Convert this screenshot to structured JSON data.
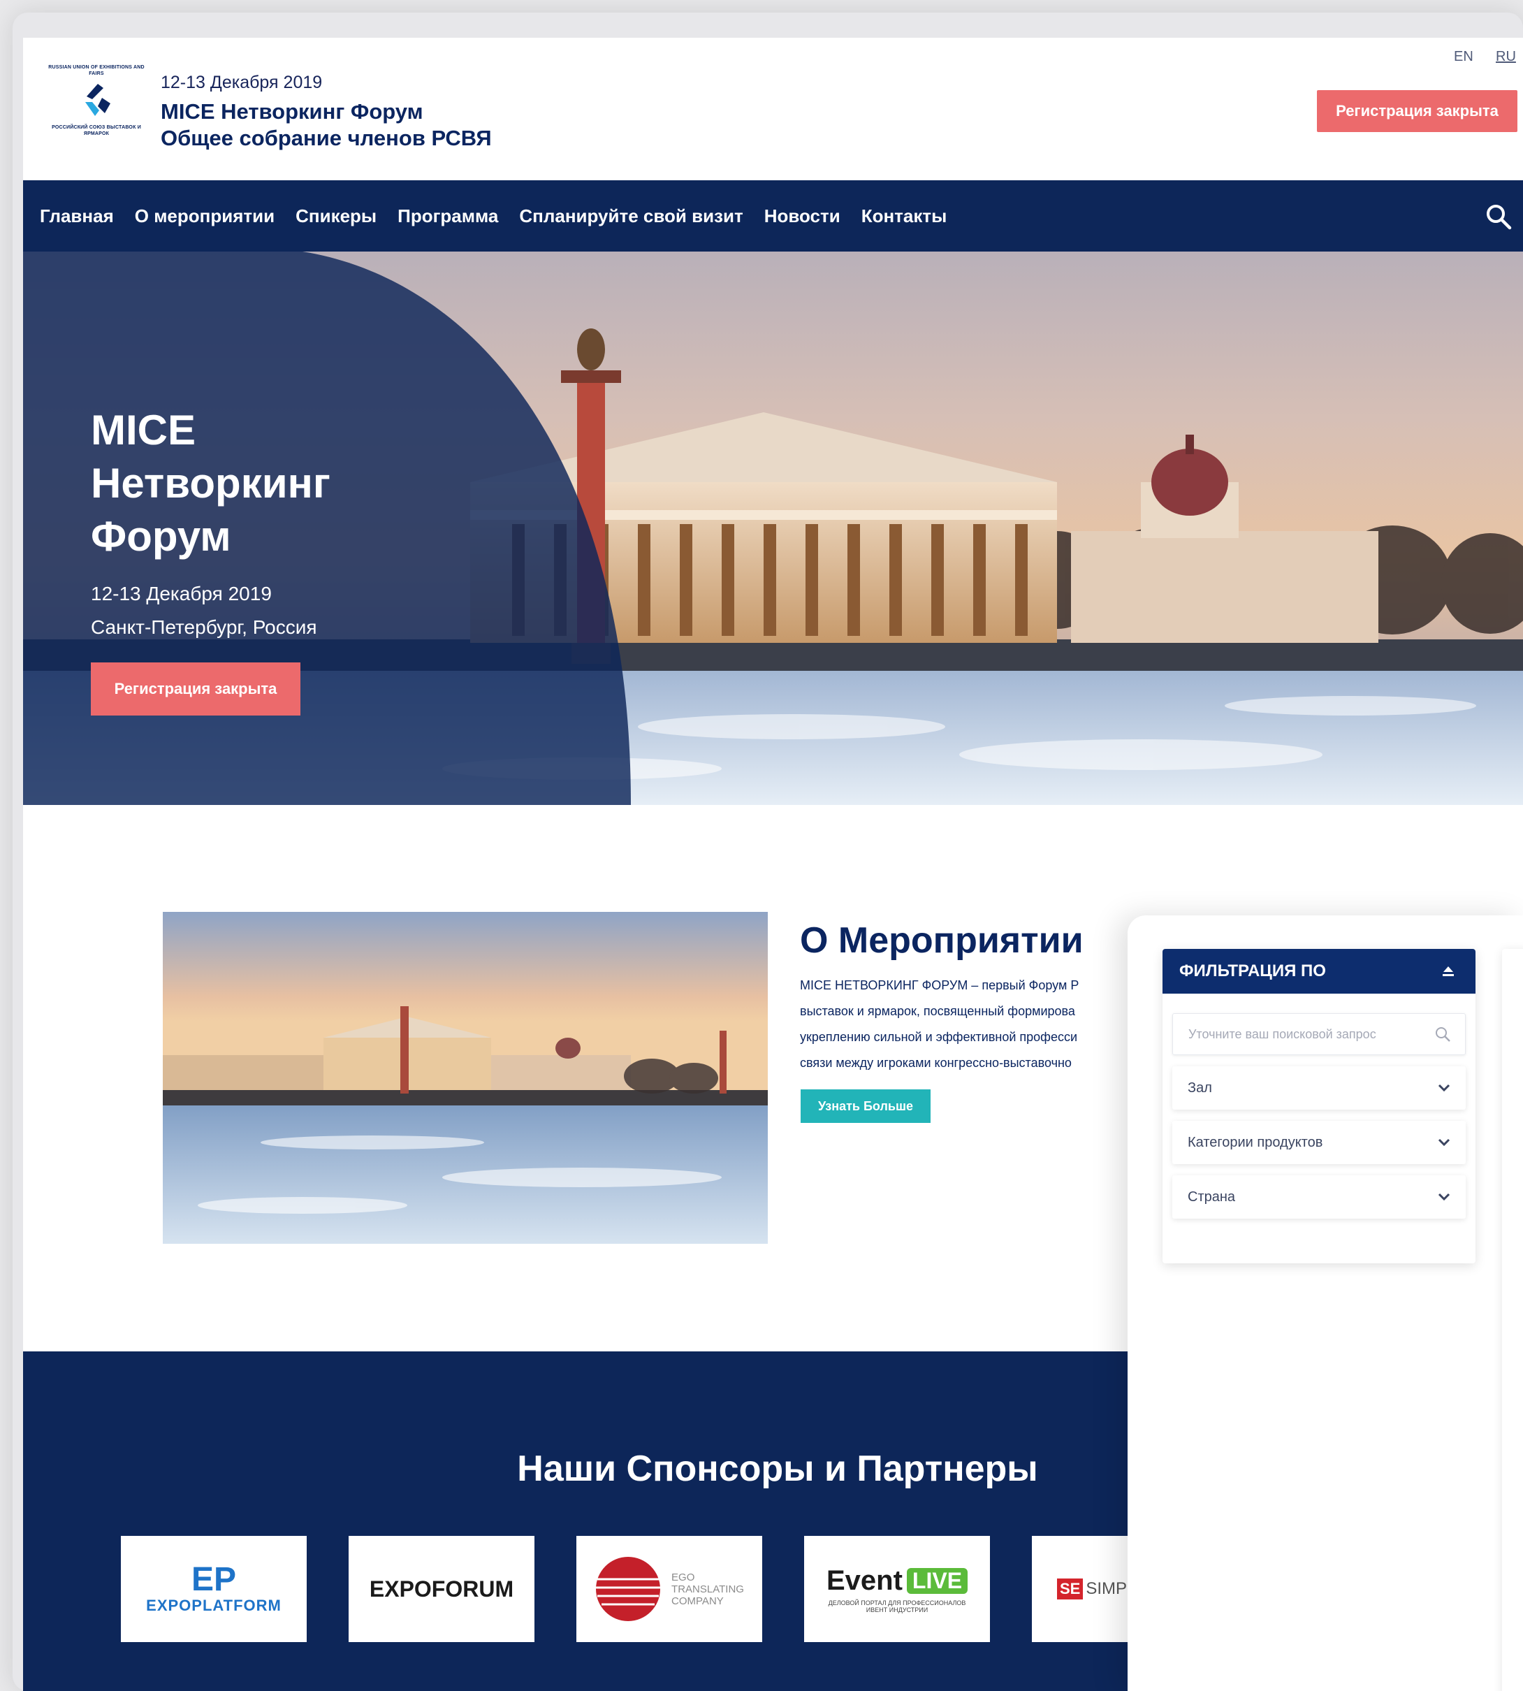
{
  "header": {
    "logo_top": "RUSSIAN UNION OF EXHIBITIONS AND FAIRS",
    "logo_bottom": "РОССИЙСКИЙ СОЮЗ ВЫСТАВОК И ЯРМАРОК",
    "date": "12-13 Декабря 2019",
    "title_line1": "MICE Нетворкинг Форум",
    "title_line2": "Общее собрание членов РСВЯ",
    "lang_en": "EN",
    "lang_ru": "RU",
    "register_label": "Регистрация закрыта"
  },
  "nav": {
    "items": [
      {
        "label": "Главная"
      },
      {
        "label": "О мероприятии"
      },
      {
        "label": "Спикеры"
      },
      {
        "label": "Программа"
      },
      {
        "label": "Спланируйте свой визит"
      },
      {
        "label": "Новости"
      },
      {
        "label": "Контакты"
      }
    ],
    "search_icon": "search-icon"
  },
  "hero": {
    "title": "MICE Нетворкинг Форум",
    "date": "12-13 Декабря 2019",
    "location": "Санкт-Петербург, Россия",
    "register_label": "Регистрация закрыта"
  },
  "about": {
    "title": "О Мероприятии",
    "text_lines": [
      "MICE НЕТВОРКИНГ ФОРУМ – первый Форум Р",
      "выставок и ярмарок, посвященный формирова",
      "укреплению сильной и эффективной професси",
      "связи между игроками конгрессно-выставочно"
    ],
    "button_label": "Узнать Больше"
  },
  "sponsors": {
    "title": "Наши Спонсоры и Партнеры",
    "logos": [
      {
        "name": "EXPOPLATFORM",
        "mark": "EP"
      },
      {
        "name": "EXPOFORUM"
      },
      {
        "name": "EGO TRANSLATING COMPANY",
        "line1": "EGO",
        "line2": "TRANSLATING",
        "line3": "COMPANY"
      },
      {
        "name": "Event LIVE",
        "word1": "Event",
        "word2": "LIVE",
        "tagline": "ДЕЛОВОЙ ПОРТАЛ ДЛЯ ПРОФЕССИОНАЛОВ ИВЕНТ ИНДУСТРИИ"
      },
      {
        "name": "SE SIMP",
        "mark": "SE",
        "text": "SIMP"
      }
    ]
  },
  "filter": {
    "title": "ФИЛЬТРАЦИЯ ПО",
    "search_placeholder": "Уточните ваш поисковой запрос",
    "rows": [
      {
        "label": "Зал"
      },
      {
        "label": "Категории продуктов"
      },
      {
        "label": "Страна"
      }
    ]
  },
  "colors": {
    "navy": "#0d2659",
    "coral": "#ec6a6c",
    "teal": "#22b4b8"
  }
}
